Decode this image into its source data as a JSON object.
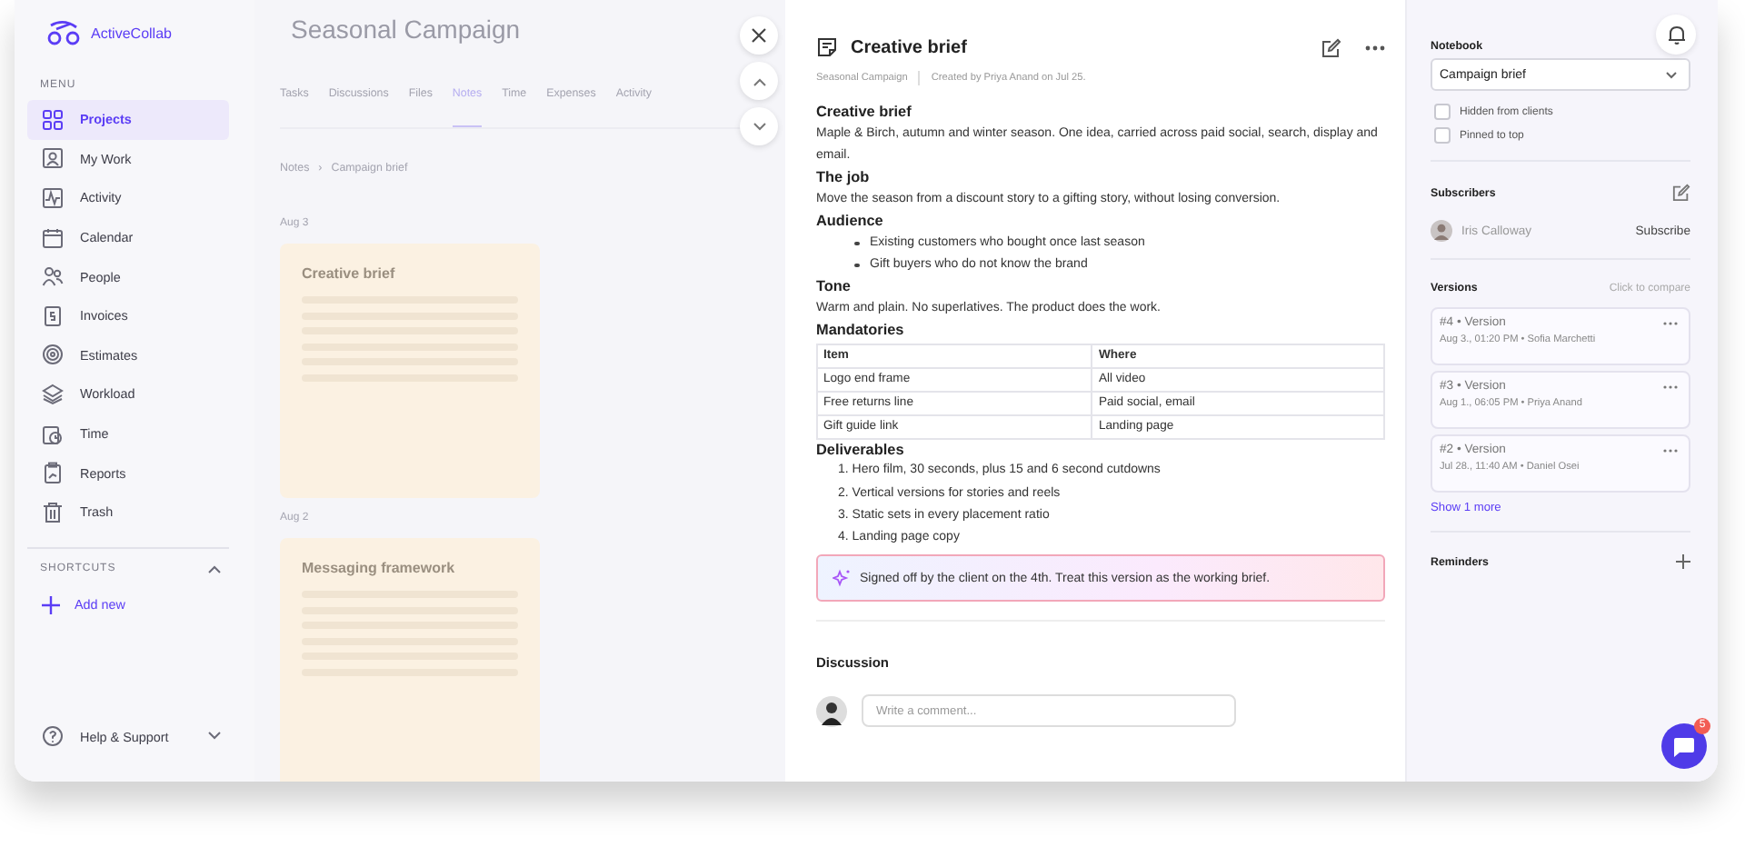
{
  "logo": {
    "name": "ActiveCollab"
  },
  "sidebar": {
    "menu_label": "MENU",
    "items": [
      {
        "label": "Projects",
        "kind": "grid",
        "selected": true
      },
      {
        "label": "My Work",
        "kind": "badge",
        "selected": false
      },
      {
        "label": "Activity",
        "kind": "pulse",
        "selected": false
      },
      {
        "label": "Calendar",
        "kind": "calendar",
        "selected": false
      },
      {
        "label": "People",
        "kind": "people",
        "selected": false
      },
      {
        "label": "Invoices",
        "kind": "invoice",
        "selected": false
      },
      {
        "label": "Estimates",
        "kind": "target",
        "selected": false
      },
      {
        "label": "Workload",
        "kind": "layers",
        "selected": false
      },
      {
        "label": "Time",
        "kind": "clock",
        "selected": false
      },
      {
        "label": "Reports",
        "kind": "clipboard",
        "selected": false
      },
      {
        "label": "Trash",
        "kind": "trash",
        "selected": false
      }
    ],
    "shortcuts_label": "SHORTCUTS",
    "shortcuts_expanded": true,
    "add_new": "Add new",
    "help": "Help & Support"
  },
  "project": {
    "title": "Seasonal Campaign",
    "tabs": [
      {
        "label": "Tasks",
        "selected": false
      },
      {
        "label": "Discussions",
        "selected": false
      },
      {
        "label": "Files",
        "selected": false
      },
      {
        "label": "Notes",
        "selected": true
      },
      {
        "label": "Time",
        "selected": false
      },
      {
        "label": "Expenses",
        "selected": false
      },
      {
        "label": "Activity",
        "selected": false
      }
    ],
    "breadcrumb": {
      "separator": "›",
      "items": [
        "Notes",
        "Campaign brief"
      ]
    },
    "groups": [
      {
        "date": "Aug 3",
        "title": "Creative brief"
      },
      {
        "date": "Aug 2",
        "title": "Messaging framework"
      }
    ]
  },
  "note": {
    "title": "Creative brief",
    "project": "Seasonal Campaign",
    "created": "Created by Priya Anand on Jul 25.",
    "blocks": [
      {
        "kind": "heading",
        "text": "Creative brief"
      },
      {
        "kind": "paragraph",
        "text": "Maple & Birch, autumn and winter season. One idea, carried across paid social, search, display and email."
      },
      {
        "kind": "heading",
        "text": "The job"
      },
      {
        "kind": "paragraph",
        "text": "Move the season from a discount story to a gifting story, without losing conversion."
      },
      {
        "kind": "heading",
        "text": "Audience"
      },
      {
        "kind": "bullets",
        "items": [
          "Existing customers who bought once last season",
          "Gift buyers who do not know the brand"
        ]
      },
      {
        "kind": "heading",
        "text": "Tone"
      },
      {
        "kind": "paragraph",
        "text": "Warm and plain. No superlatives. The product does the work."
      },
      {
        "kind": "heading",
        "text": "Mandatories"
      },
      {
        "kind": "table",
        "columns": [
          "Item",
          "Where"
        ],
        "rows": [
          [
            "Logo end frame",
            "All video"
          ],
          [
            "Free returns line",
            "Paid social, email"
          ],
          [
            "Gift guide link",
            "Landing page"
          ]
        ]
      },
      {
        "kind": "heading",
        "text": "Deliverables"
      },
      {
        "kind": "numbered",
        "items": [
          "1. Hero film, 30 seconds, plus 15 and 6 second cutdowns",
          "2. Vertical versions for stories and reels",
          "3. Static sets in every placement ratio",
          "4. Landing page copy"
        ]
      },
      {
        "kind": "callout",
        "text": "Signed off by the client on the 4th. Treat this version as the working brief."
      }
    ],
    "discussion": {
      "title": "Discussion",
      "placeholder": "Write a comment..."
    }
  },
  "details": {
    "notebook_label": "Notebook",
    "notebook": "Campaign brief",
    "options": [
      {
        "label": "Hidden from clients",
        "checked": false
      },
      {
        "label": "Pinned to top",
        "checked": false
      }
    ],
    "subscribers_title": "Subscribers",
    "subscribers": [
      {
        "name": "Iris Calloway",
        "action": "Subscribe"
      }
    ],
    "versions_title": "Versions",
    "versions_hint": "Click to compare",
    "versions": [
      {
        "title": "#4 • Version",
        "meta": "Aug 3., 01:20 PM • Sofia Marchetti"
      },
      {
        "title": "#3 • Version",
        "meta": "Aug 1., 06:05 PM • Priya Anand"
      },
      {
        "title": "#2 • Version",
        "meta": "Jul 28., 11:40 AM • Daniel Osei"
      }
    ],
    "show_more": "Show 1 more",
    "reminders_title": "Reminders"
  },
  "chat": {
    "badge": "5"
  }
}
